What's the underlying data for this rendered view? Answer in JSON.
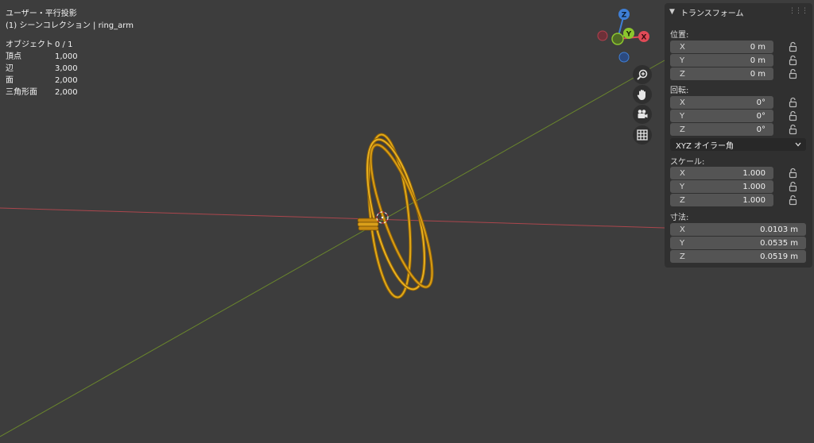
{
  "viewport": {
    "view_name": "ユーザー・平行投影",
    "collection_line": "(1) シーンコレクション | ring_arm",
    "stats": [
      {
        "label": "オブジェクト",
        "value": "0 / 1"
      },
      {
        "label": "頂点",
        "value": "1,000"
      },
      {
        "label": "辺",
        "value": "3,000"
      },
      {
        "label": "面",
        "value": "2,000"
      },
      {
        "label": "三角形面",
        "value": "2,000"
      }
    ],
    "gizmo": {
      "z": "Z",
      "y": "Y",
      "x": "X"
    },
    "colors": {
      "background": "#3d3d3d",
      "x_axis": "#b7484f",
      "y_axis": "#6f8f2b",
      "ring": "#d49a12"
    }
  },
  "view_buttons": {
    "zoom": "zoom-icon",
    "pan": "hand-icon",
    "camera": "camera-icon",
    "ortho": "grid-icon"
  },
  "panel": {
    "title": "トランスフォーム",
    "location": {
      "label": "位置:",
      "fields": [
        {
          "axis": "X",
          "value": "0 m"
        },
        {
          "axis": "Y",
          "value": "0 m"
        },
        {
          "axis": "Z",
          "value": "0 m"
        }
      ]
    },
    "rotation": {
      "label": "回転:",
      "fields": [
        {
          "axis": "X",
          "value": "0°"
        },
        {
          "axis": "Y",
          "value": "0°"
        },
        {
          "axis": "Z",
          "value": "0°"
        }
      ]
    },
    "rotation_mode": "XYZ オイラー角",
    "scale": {
      "label": "スケール:",
      "fields": [
        {
          "axis": "X",
          "value": "1.000"
        },
        {
          "axis": "Y",
          "value": "1.000"
        },
        {
          "axis": "Z",
          "value": "1.000"
        }
      ]
    },
    "dimensions": {
      "label": "寸法:",
      "fields": [
        {
          "axis": "X",
          "value": "0.0103 m"
        },
        {
          "axis": "Y",
          "value": "0.0535 m"
        },
        {
          "axis": "Z",
          "value": "0.0519 m"
        }
      ]
    }
  }
}
